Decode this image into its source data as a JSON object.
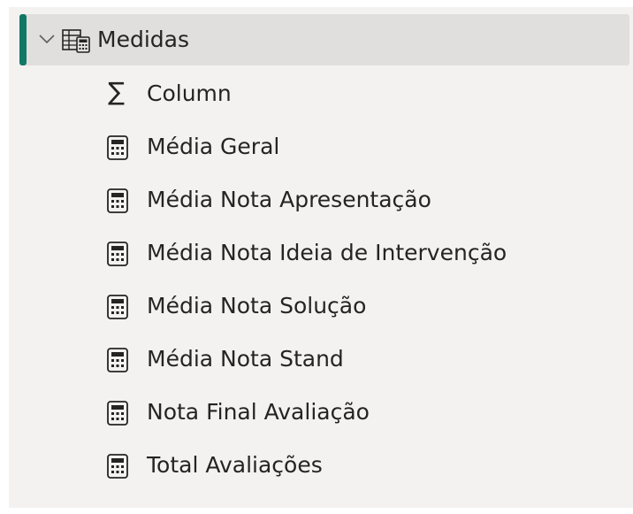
{
  "table": {
    "name": "Medidas",
    "expanded": true,
    "accent_color": "#117865",
    "icon": "calculator-table-icon"
  },
  "fields": [
    {
      "label": "Column",
      "icon": "sigma-icon"
    },
    {
      "label": "Média Geral",
      "icon": "calculator-icon"
    },
    {
      "label": "Média Nota Apresentação",
      "icon": "calculator-icon"
    },
    {
      "label": "Média Nota Ideia de Intervenção",
      "icon": "calculator-icon"
    },
    {
      "label": "Média Nota Solução",
      "icon": "calculator-icon"
    },
    {
      "label": "Média Nota Stand",
      "icon": "calculator-icon"
    },
    {
      "label": "Nota Final Avaliação",
      "icon": "calculator-icon"
    },
    {
      "label": "Total Avaliações",
      "icon": "calculator-icon"
    }
  ]
}
